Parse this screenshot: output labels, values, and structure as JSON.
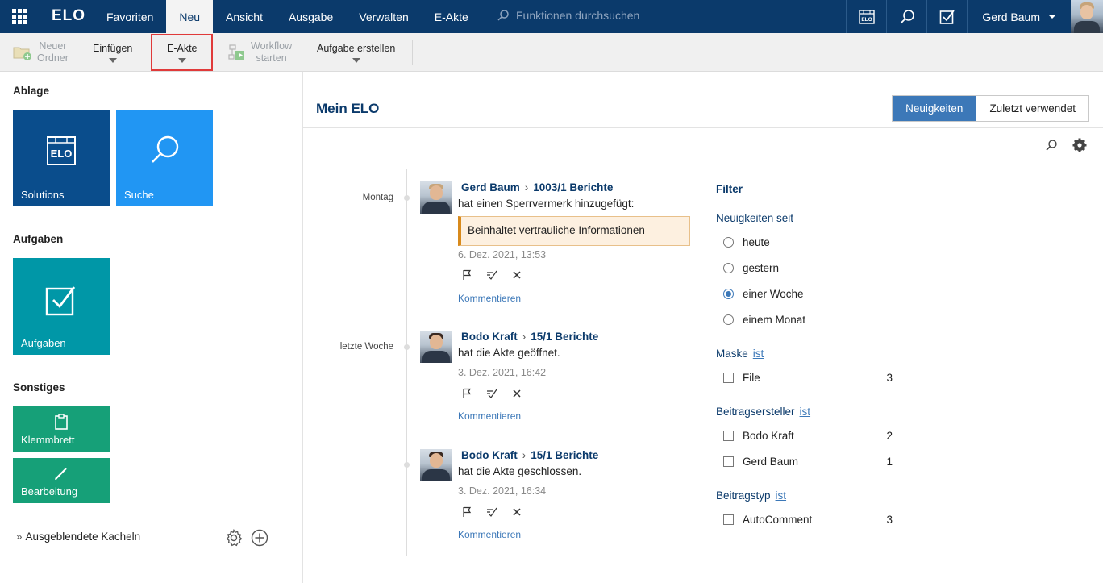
{
  "topbar": {
    "logo": "ELO",
    "nav": [
      "Favoriten",
      "Neu",
      "Ansicht",
      "Ausgabe",
      "Verwalten",
      "E-Akte"
    ],
    "active_nav": "Neu",
    "search_placeholder": "Funktionen durchsuchen",
    "user_name": "Gerd Baum",
    "color_bg": "#0b3a6b"
  },
  "toolbar": {
    "new_folder_l1": "Neuer",
    "new_folder_l2": "Ordner",
    "insert": "Einfügen",
    "eakte": "E-Akte",
    "workflow_l1": "Workflow",
    "workflow_l2": "starten",
    "task_create": "Aufgabe erstellen"
  },
  "left": {
    "ablage_title": "Ablage",
    "tiles_ablage": [
      {
        "label": "Solutions",
        "icon": "elo-archive-icon",
        "color": "#0a4d8c"
      },
      {
        "label": "Suche",
        "icon": "search-icon",
        "color": "#2196f3"
      }
    ],
    "aufgaben_title": "Aufgaben",
    "tile_aufgaben": {
      "label": "Aufgaben",
      "icon": "checkbox-icon",
      "color": "#0097a7"
    },
    "sonstiges_title": "Sonstiges",
    "tiles_sonstiges": [
      {
        "label": "Klemmbrett",
        "icon": "clipboard-icon",
        "color": "#16a078"
      },
      {
        "label": "Bearbeitung",
        "icon": "pencil-icon",
        "color": "#16a078"
      }
    ],
    "hidden_tiles": "Ausgeblendete Kacheln"
  },
  "main": {
    "title": "Mein ELO",
    "tab_news": "Neuigkeiten",
    "tab_recent": "Zuletzt verwendet",
    "timeline_labels": [
      "Montag",
      "letzte Woche"
    ],
    "entries": [
      {
        "user": "Gerd Baum",
        "target": "1003/1 Berichte",
        "action": "hat einen Sperrvermerk hinzugefügt:",
        "note": "Beinhaltet vertrauliche Informationen",
        "time": "6. Dez. 2021, 13:53",
        "comment": "Kommentieren"
      },
      {
        "user": "Bodo Kraft",
        "target": "15/1 Berichte",
        "action": "hat die Akte geöffnet.",
        "time": "3. Dez. 2021, 16:42",
        "comment": "Kommentieren"
      },
      {
        "user": "Bodo Kraft",
        "target": "15/1 Berichte",
        "action": "hat die Akte geschlossen.",
        "time": "3. Dez. 2021, 16:34",
        "comment": "Kommentieren"
      }
    ]
  },
  "filter": {
    "title": "Filter",
    "since_head": "Neuigkeiten seit",
    "since_options": [
      "heute",
      "gestern",
      "einer Woche",
      "einem Monat"
    ],
    "since_selected": "einer Woche",
    "mask_head": "Maske",
    "is_link": "ist",
    "mask_items": [
      {
        "label": "File",
        "count": "3"
      }
    ],
    "author_head": "Beitragsersteller",
    "author_items": [
      {
        "label": "Bodo Kraft",
        "count": "2"
      },
      {
        "label": "Gerd Baum",
        "count": "1"
      }
    ],
    "type_head": "Beitragstyp",
    "type_items": [
      {
        "label": "AutoComment",
        "count": "3"
      }
    ]
  }
}
